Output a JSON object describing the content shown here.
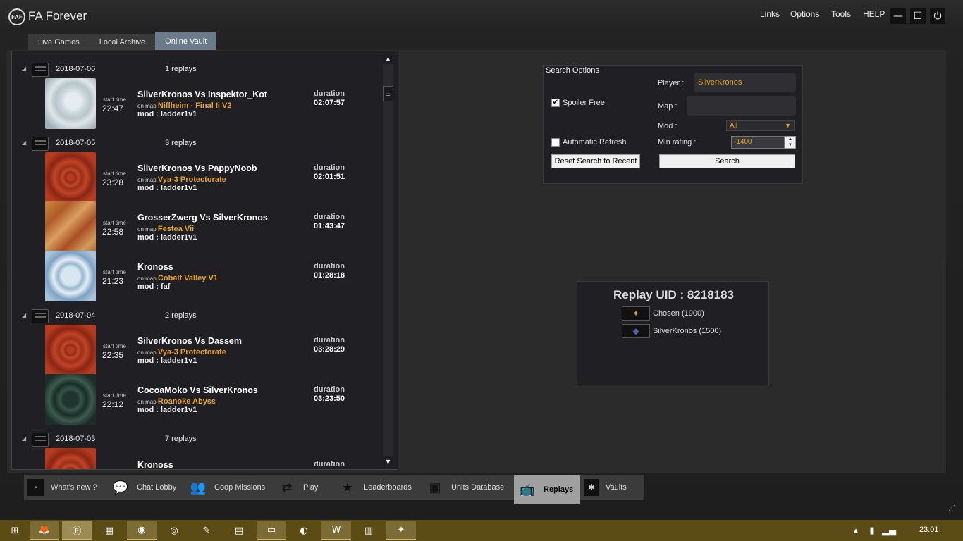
{
  "window": {
    "logo_text": "FAF",
    "title": "FA Forever",
    "menu": [
      "Links",
      "Options",
      "Tools",
      "HELP"
    ]
  },
  "tabs": [
    "Live Games",
    "Local Archive",
    "Online Vault"
  ],
  "days": [
    {
      "date": "2018-07-06",
      "count": "1 replays",
      "replays": [
        {
          "start_label": "start time",
          "time": "22:47",
          "title": "SilverKronos Vs Inspektor_Kot",
          "map_prefix": "on map",
          "map": "Niflheim - Final Ii V2",
          "mod": "mod : ladder1v1",
          "dur_label": "duration",
          "duration": "02:07:57",
          "thumb": "ice"
        }
      ]
    },
    {
      "date": "2018-07-05",
      "count": "3 replays",
      "replays": [
        {
          "start_label": "start time",
          "time": "23:28",
          "title": "SilverKronos Vs PappyNoob",
          "map_prefix": "on map",
          "map": "Vya-3 Protectorate",
          "mod": "mod : ladder1v1",
          "dur_label": "duration",
          "duration": "02:01:51",
          "thumb": "red"
        },
        {
          "start_label": "start time",
          "time": "22:58",
          "title": "GrosserZwerg Vs SilverKronos",
          "map_prefix": "on map",
          "map": "Festea Vii",
          "mod": "mod : ladder1v1",
          "dur_label": "duration",
          "duration": "01:43:47",
          "thumb": "desert"
        },
        {
          "start_label": "start time",
          "time": "21:23",
          "title": "Kronoss",
          "map_prefix": "on map",
          "map": "Cobalt Valley V1",
          "mod": "mod : faf",
          "dur_label": "duration",
          "duration": "01:28:18",
          "thumb": "snow"
        }
      ]
    },
    {
      "date": "2018-07-04",
      "count": "2 replays",
      "replays": [
        {
          "start_label": "start time",
          "time": "22:35",
          "title": "SilverKronos Vs Dassem",
          "map_prefix": "on map",
          "map": "Vya-3 Protectorate",
          "mod": "mod : ladder1v1",
          "dur_label": "duration",
          "duration": "03:28:29",
          "thumb": "red"
        },
        {
          "start_label": "start time",
          "time": "22:12",
          "title": "CocoaMoko Vs SilverKronos",
          "map_prefix": "on map",
          "map": "Roanoke Abyss",
          "mod": "mod : ladder1v1",
          "dur_label": "duration",
          "duration": "03:23:50",
          "thumb": "green"
        }
      ]
    },
    {
      "date": "2018-07-03",
      "count": "7 replays",
      "replays": [
        {
          "start_label": "",
          "time": "",
          "title": "Kronoss",
          "map_prefix": "",
          "map": "",
          "mod": "",
          "dur_label": "duration",
          "duration": "",
          "thumb": "red"
        }
      ]
    }
  ],
  "search": {
    "legend": "Search Options",
    "player_label": "Player :",
    "player_value": "SilverKronos",
    "map_label": "Map :",
    "map_value": "",
    "spoiler_label": "Spoiler Free",
    "spoiler_checked": true,
    "auto_refresh_label": "Automatic Refresh",
    "auto_refresh_checked": false,
    "mod_label": "Mod :",
    "mod_value": "All",
    "min_rating_label": "Min rating :",
    "min_rating_value": "-1400",
    "reset_label": "Reset Search to Recent",
    "search_label": "Search"
  },
  "replay_info": {
    "uid_title": "Replay UID : 8218183",
    "players": [
      {
        "name": "Chosen (1900)",
        "faction": "aeon"
      },
      {
        "name": "SilverKronos (1500)",
        "faction": "uef"
      }
    ]
  },
  "bottom_nav": [
    "What's new ?",
    "Chat Lobby",
    "Coop Missions",
    "Play",
    "Leaderboards",
    "Units Database",
    "Replays",
    "Vaults"
  ],
  "taskbar": {
    "clock": "23:01"
  },
  "colors": {
    "accent": "#e6a328",
    "active_tab": "#6b7b8b",
    "taskbar": "#5a4c14"
  }
}
